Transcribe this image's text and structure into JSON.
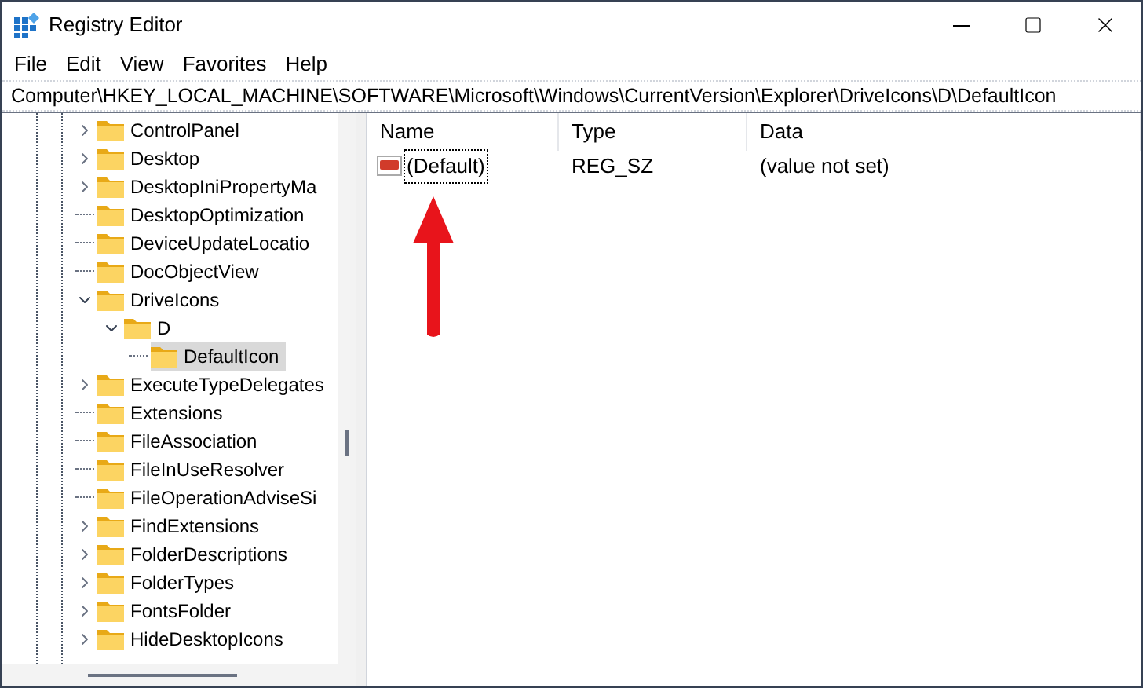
{
  "window": {
    "title": "Registry Editor"
  },
  "menu": [
    "File",
    "Edit",
    "View",
    "Favorites",
    "Help"
  ],
  "address": "Computer\\HKEY_LOCAL_MACHINE\\SOFTWARE\\Microsoft\\Windows\\CurrentVersion\\Explorer\\DriveIcons\\D\\DefaultIcon",
  "tree": [
    {
      "label": "ControlPanel",
      "kind": "collapsed",
      "selected": false
    },
    {
      "label": "Desktop",
      "kind": "collapsed",
      "selected": false
    },
    {
      "label": "DesktopIniPropertyMa",
      "kind": "collapsed",
      "selected": false
    },
    {
      "label": "DesktopOptimization",
      "kind": "leaf",
      "selected": false
    },
    {
      "label": "DeviceUpdateLocatio",
      "kind": "leaf",
      "selected": false
    },
    {
      "label": "DocObjectView",
      "kind": "leaf",
      "selected": false
    },
    {
      "label": "DriveIcons",
      "kind": "expanded",
      "selected": false,
      "children": [
        {
          "label": "D",
          "kind": "expanded",
          "selected": false,
          "children": [
            {
              "label": "DefaultIcon",
              "kind": "leaf",
              "selected": true
            }
          ]
        }
      ]
    },
    {
      "label": "ExecuteTypeDelegates",
      "kind": "collapsed",
      "selected": false
    },
    {
      "label": "Extensions",
      "kind": "leaf",
      "selected": false
    },
    {
      "label": "FileAssociation",
      "kind": "leaf",
      "selected": false
    },
    {
      "label": "FileInUseResolver",
      "kind": "leaf",
      "selected": false
    },
    {
      "label": "FileOperationAdviseSi",
      "kind": "leaf",
      "selected": false
    },
    {
      "label": "FindExtensions",
      "kind": "collapsed",
      "selected": false
    },
    {
      "label": "FolderDescriptions",
      "kind": "collapsed",
      "selected": false
    },
    {
      "label": "FolderTypes",
      "kind": "collapsed",
      "selected": false
    },
    {
      "label": "FontsFolder",
      "kind": "collapsed",
      "selected": false
    },
    {
      "label": "HideDesktopIcons",
      "kind": "collapsed",
      "selected": false
    }
  ],
  "values": {
    "columns": [
      "Name",
      "Type",
      "Data"
    ],
    "rows": [
      {
        "name": "(Default)",
        "type": "REG_SZ",
        "data": "(value not set)",
        "selected": true
      }
    ]
  }
}
